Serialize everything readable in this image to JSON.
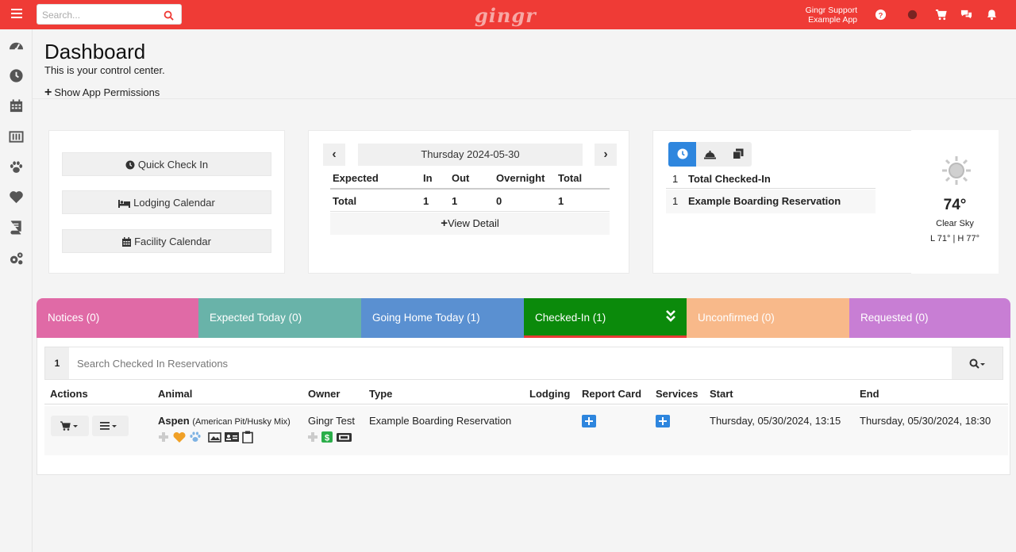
{
  "topbar": {
    "search_placeholder": "Search...",
    "logo": "gingr",
    "user_name": "Gingr Support",
    "app_name": "Example App",
    "color": "#ef3b36"
  },
  "sidebar": {
    "icons": [
      "dashboard-icon",
      "clock-icon",
      "calendar-icon",
      "barcode-icon",
      "paw-icon",
      "heart-icon",
      "book-icon",
      "gears-icon"
    ]
  },
  "header": {
    "title": "Dashboard",
    "subtitle": "This is your control center.",
    "permissions_link": "Show App Permissions"
  },
  "quick_actions": [
    "Quick Check In",
    "Lodging Calendar",
    "Facility Calendar"
  ],
  "summary": {
    "date": "Thursday 2024-05-30",
    "headers": [
      "Expected",
      "In",
      "Out",
      "Overnight",
      "Total"
    ],
    "row": [
      "Total",
      "1",
      "1",
      "0",
      "1"
    ],
    "view_detail": "View Detail"
  },
  "checked_in_panel": {
    "rows": [
      {
        "count": "1",
        "label": "Total Checked-In"
      },
      {
        "count": "1",
        "label": "Example Boarding Reservation"
      }
    ]
  },
  "weather": {
    "temp": "74°",
    "condition": "Clear Sky",
    "range": "L 71° | H 77°"
  },
  "tabs": [
    {
      "label": "Notices (0)",
      "color": "#e06aa6"
    },
    {
      "label": "Expected Today (0)",
      "color": "#69b3a9"
    },
    {
      "label": "Going Home Today (1)",
      "color": "#5a90d1"
    },
    {
      "label": "Checked-In (1)",
      "color": "#0b8a0b"
    },
    {
      "label": "Unconfirmed (0)",
      "color": "#f8b98a"
    },
    {
      "label": "Requested (0)",
      "color": "#c87ed4"
    }
  ],
  "reservations": {
    "count": "1",
    "search_placeholder": "Search Checked In Reservations",
    "columns": [
      "Actions",
      "Animal",
      "Owner",
      "Type",
      "Lodging",
      "Report Card",
      "Services",
      "Start",
      "End"
    ],
    "rows": [
      {
        "animal": "Aspen",
        "breed": "(American Pit/Husky Mix)",
        "owner": "Gingr Test",
        "type": "Example Boarding Reservation",
        "lodging": "",
        "start": "Thursday, 05/30/2024, 13:15",
        "end": "Thursday, 05/30/2024, 18:30"
      }
    ]
  }
}
